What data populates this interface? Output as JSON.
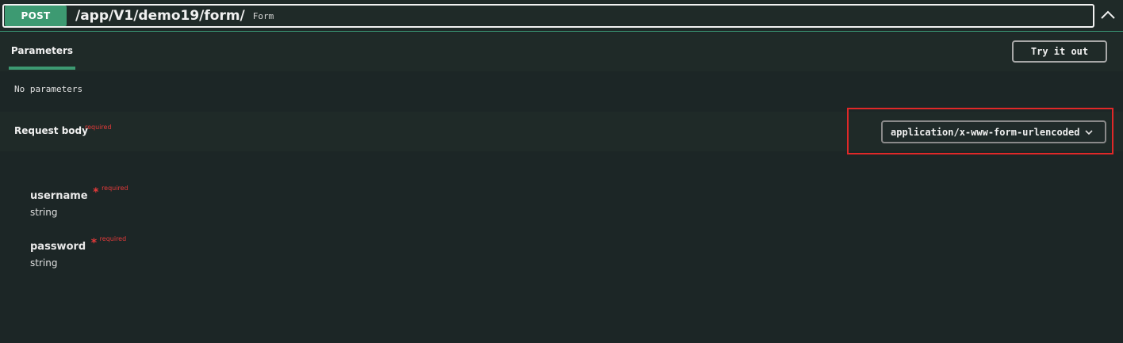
{
  "operation": {
    "method": "POST",
    "path": "/app/V1/demo19/form/",
    "description": "Form"
  },
  "parameters": {
    "tab_label": "Parameters",
    "try_button_label": "Try it out",
    "empty_text": "No parameters"
  },
  "request_body": {
    "title": "Request body",
    "required_label": "required",
    "content_type": "application/x-www-form-urlencoded"
  },
  "fields": [
    {
      "name": "username",
      "required_label": "required",
      "type": "string"
    },
    {
      "name": "password",
      "required_label": "required",
      "type": "string"
    }
  ],
  "icons": {
    "collapse": "chevron-up-icon",
    "select": "chevron-down-icon",
    "required_marker": "asterisk-icon"
  },
  "colors": {
    "post_method": "#3d9a72",
    "required": "#e43a3a",
    "highlight": "#e02828",
    "background": "#1c2626"
  }
}
